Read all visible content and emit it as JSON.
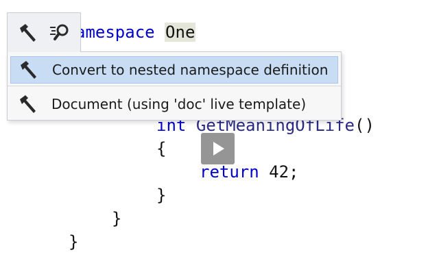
{
  "code": {
    "line1": {
      "keyword_fragment": "amespace",
      "identifier": "One"
    },
    "line2": {
      "type": "int",
      "method": "GetMeaningOfLife",
      "parens": "()"
    },
    "line3": "{",
    "line4": {
      "keyword": "return",
      "value": "42;"
    },
    "line5": "}",
    "line6": "}",
    "line7": "}"
  },
  "toolbar": {
    "icons": [
      "hammer-icon",
      "search-settings-icon"
    ]
  },
  "menu": {
    "items": [
      {
        "label": "Convert to nested namespace definition",
        "icon": "hammer-icon",
        "selected": true
      },
      {
        "label": "Document (using 'doc' live template)",
        "icon": "hammer-icon",
        "selected": false
      }
    ]
  },
  "colors": {
    "keyword": "#0000cc",
    "method": "#2b2b86",
    "selection": "#c8dcf3",
    "popup_bg": "#f7f7f7",
    "highlight": "#e3e6d8"
  },
  "overlay": {
    "icon": "play-icon"
  }
}
